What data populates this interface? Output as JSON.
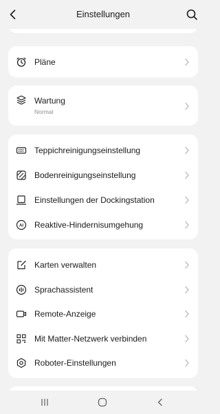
{
  "header": {
    "title": "Einstellungen",
    "back_icon": "chevron-left-icon",
    "search_icon": "search-icon"
  },
  "groups": [
    {
      "items": [
        {
          "label": "Pläne",
          "icon": "alarm-clock-icon"
        }
      ]
    },
    {
      "items": [
        {
          "label": "Wartung",
          "sublabel": "Normal",
          "icon": "layers-icon"
        }
      ]
    },
    {
      "items": [
        {
          "label": "Teppichreinigungseinstellung",
          "icon": "carpet-icon"
        },
        {
          "label": "Bodenreinigungseinstellung",
          "icon": "floor-icon"
        },
        {
          "label": "Einstellungen der Dockingstation",
          "icon": "dock-icon"
        },
        {
          "label": "Reaktive-Hindernisumgehung",
          "icon": "ai-icon"
        }
      ]
    },
    {
      "items": [
        {
          "label": "Karten verwalten",
          "icon": "map-edit-icon"
        },
        {
          "label": "Sprachassistent",
          "icon": "voice-icon"
        },
        {
          "label": "Remote-Anzeige",
          "icon": "video-icon"
        },
        {
          "label": "Mit Matter-Netzwerk verbinden",
          "icon": "qr-code-icon"
        },
        {
          "label": "Roboter-Einstellungen",
          "icon": "hexagon-gear-icon"
        }
      ]
    }
  ],
  "navbar": {
    "recents_icon": "recents-icon",
    "home_icon": "home-icon",
    "back_icon": "back-icon"
  },
  "colors": {
    "background": "#f2f2f2",
    "card": "#ffffff",
    "text": "#1a1a1a",
    "secondary_text": "#8c8c8c",
    "chevron": "#b5b5b5"
  }
}
